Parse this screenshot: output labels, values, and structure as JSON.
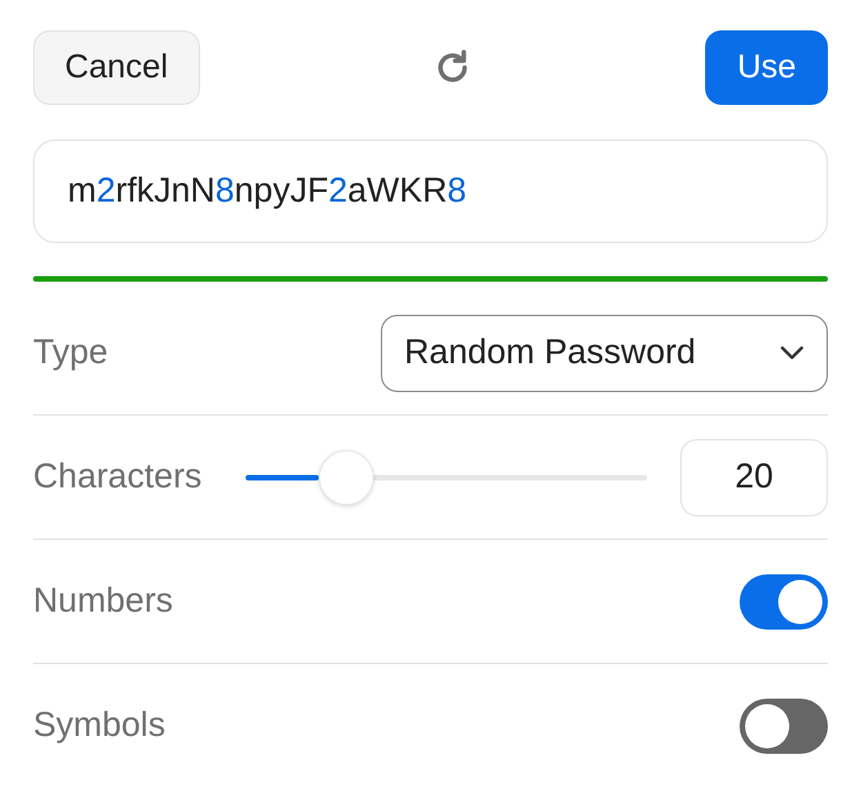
{
  "toolbar": {
    "cancel": "Cancel",
    "use": "Use"
  },
  "password": {
    "value": "m2rfkJnN8npyJF2aWKR8"
  },
  "strength": {
    "level": 1
  },
  "options": [
    {
      "kind": "select",
      "label": "Type",
      "value": "Random Password"
    },
    {
      "kind": "slider",
      "label": "Characters",
      "level": 0.18,
      "value": "20"
    },
    {
      "kind": "toggle",
      "label": "Numbers",
      "on": true
    },
    {
      "kind": "toggle",
      "label": "Symbols",
      "on": false
    }
  ]
}
